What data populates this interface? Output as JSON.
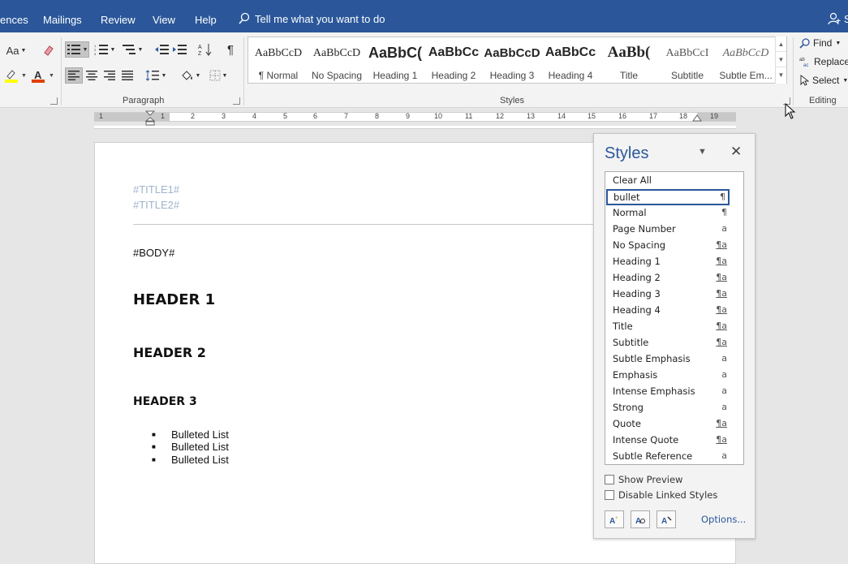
{
  "menu": {
    "tabs": [
      "ences",
      "Mailings",
      "Review",
      "View",
      "Help"
    ],
    "tell_me": "Tell me what you want to do",
    "user_initial": "S"
  },
  "ribbon": {
    "font_case_label": "Aa",
    "paragraph_label": "Paragraph",
    "styles_label": "Styles",
    "editing_label": "Editing",
    "gallery": [
      {
        "sample": "AaBbCcD",
        "name": "¶ Normal",
        "style": "normal"
      },
      {
        "sample": "AaBbCcD",
        "name": "No Spacing",
        "style": "normal"
      },
      {
        "sample": "AaBbC(",
        "name": "Heading 1",
        "style": "h1"
      },
      {
        "sample": "AaBbCc",
        "name": "Heading 2",
        "style": "h2"
      },
      {
        "sample": "AaBbCcD",
        "name": "Heading 3",
        "style": "h3"
      },
      {
        "sample": "AaBbCc",
        "name": "Heading 4",
        "style": "h4"
      },
      {
        "sample": "AaBb(",
        "name": "Title",
        "style": "title"
      },
      {
        "sample": "AaBbCcI",
        "name": "Subtitle",
        "style": "subtitle"
      },
      {
        "sample": "AaBbCcD",
        "name": "Subtle Em...",
        "style": "subtle"
      }
    ],
    "editing": {
      "find": "Find",
      "replace": "Replace",
      "select": "Select"
    }
  },
  "ruler": {
    "numbers": [
      "1",
      "1",
      "2",
      "3",
      "4",
      "5",
      "6",
      "7",
      "8",
      "9",
      "10",
      "11",
      "12",
      "13",
      "14",
      "15",
      "16",
      "17",
      "18",
      "19"
    ]
  },
  "document": {
    "title1": "#TITLE1#",
    "title2": "#TITLE2#",
    "body": "#BODY#",
    "header1": "HEADER 1",
    "header2": "HEADER 2",
    "header3": "HEADER 3",
    "bullets": [
      "Bulleted List",
      "Bulleted List",
      "Bulleted List"
    ]
  },
  "styles_pane": {
    "title": "Styles",
    "items": [
      {
        "name": "Clear All",
        "mark": ""
      },
      {
        "name": "bullet",
        "mark": "¶",
        "selected": true
      },
      {
        "name": "Normal",
        "mark": "¶"
      },
      {
        "name": "Page Number",
        "mark": "a"
      },
      {
        "name": "No Spacing",
        "mark": "¶a"
      },
      {
        "name": "Heading 1",
        "mark": "¶a"
      },
      {
        "name": "Heading 2",
        "mark": "¶a"
      },
      {
        "name": "Heading 3",
        "mark": "¶a"
      },
      {
        "name": "Heading 4",
        "mark": "¶a"
      },
      {
        "name": "Title",
        "mark": "¶a"
      },
      {
        "name": "Subtitle",
        "mark": "¶a"
      },
      {
        "name": "Subtle Emphasis",
        "mark": "a"
      },
      {
        "name": "Emphasis",
        "mark": "a"
      },
      {
        "name": "Intense Emphasis",
        "mark": "a"
      },
      {
        "name": "Strong",
        "mark": "a"
      },
      {
        "name": "Quote",
        "mark": "¶a"
      },
      {
        "name": "Intense Quote",
        "mark": "¶a"
      },
      {
        "name": "Subtle Reference",
        "mark": "a"
      }
    ],
    "show_preview": "Show Preview",
    "disable_linked": "Disable Linked Styles",
    "options": "Options..."
  },
  "colors": {
    "brand": "#2b579a",
    "title_placeholder": "#9fb3cc"
  }
}
